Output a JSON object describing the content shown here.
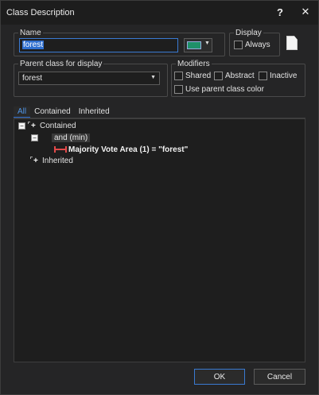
{
  "window": {
    "title": "Class Description",
    "help_icon": "help-icon",
    "close_icon": "close-icon"
  },
  "name": {
    "label": "Name",
    "value": "forest",
    "color_swatch": "#1f9069"
  },
  "display": {
    "label": "Display",
    "always_label": "Always",
    "always_checked": false,
    "icon": "document-icon"
  },
  "parent": {
    "label": "Parent class for display",
    "value": "forest"
  },
  "modifiers": {
    "label": "Modifiers",
    "shared": "Shared",
    "abstract": "Abstract",
    "inactive": "Inactive",
    "use_parent_color": "Use parent class color"
  },
  "tabs": [
    {
      "label": "All",
      "active": true
    },
    {
      "label": "Contained"
    },
    {
      "label": "Inherited"
    }
  ],
  "tree": {
    "contained": "Contained",
    "and": "and (min)",
    "rule": "Majority Vote Area (1) = \"forest\"",
    "inherited": "Inherited"
  },
  "buttons": {
    "ok": "OK",
    "cancel": "Cancel"
  },
  "colors": {
    "accent": "#2f6fcf",
    "rule_icon": "#e24a4a"
  }
}
